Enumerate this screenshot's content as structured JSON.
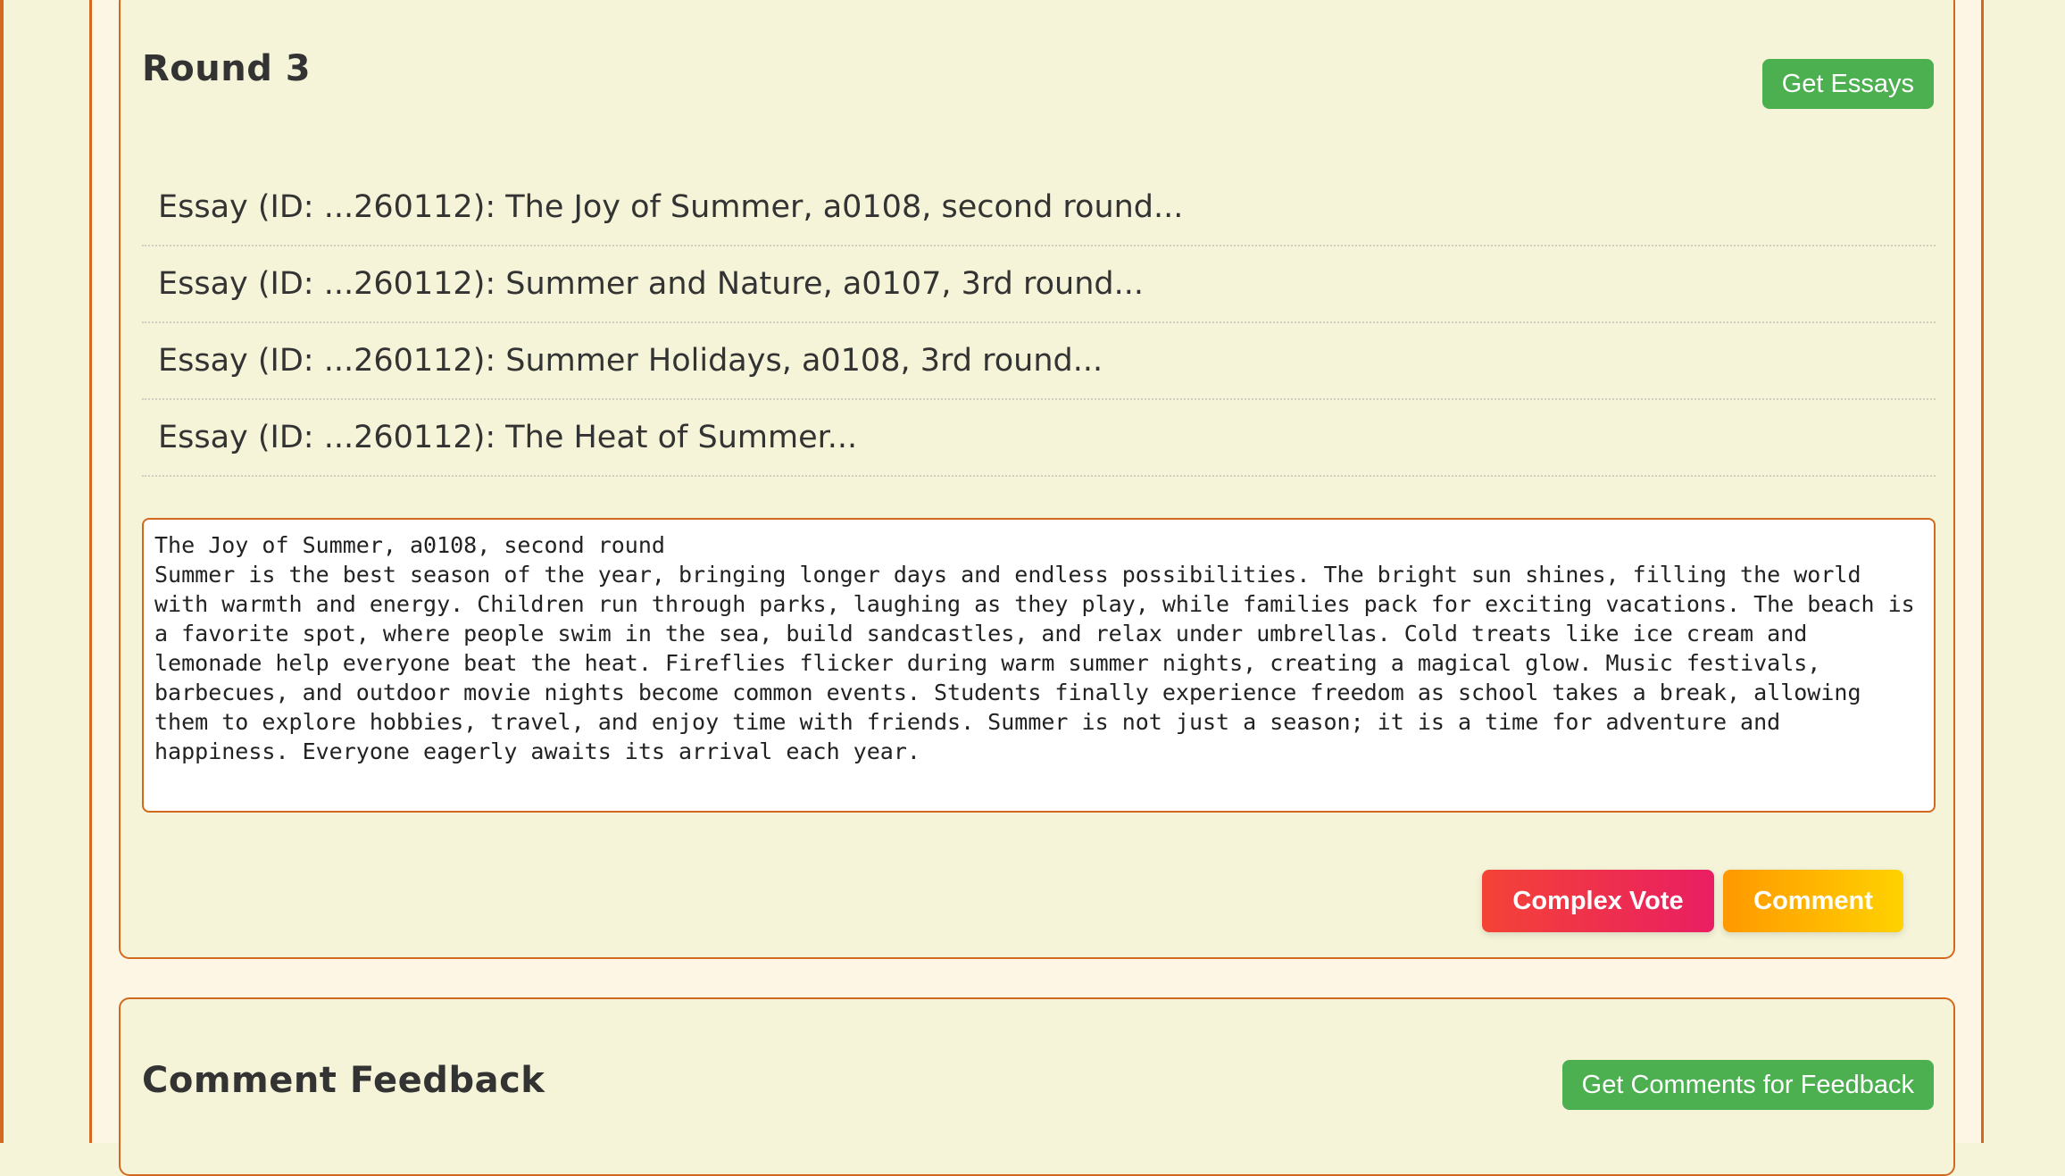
{
  "round_card": {
    "title": "Round 3",
    "get_essays_label": "Get Essays",
    "essays": [
      {
        "label": "Essay (ID: ...260112): The Joy of Summer, a0108, second round..."
      },
      {
        "label": "Essay (ID: ...260112): Summer and Nature, a0107, 3rd round..."
      },
      {
        "label": "Essay (ID: ...260112): Summer Holidays, a0108, 3rd round..."
      },
      {
        "label": "Essay (ID: ...260112): The Heat of Summer..."
      }
    ],
    "essay_text": "The Joy of Summer, a0108, second round\nSummer is the best season of the year, bringing longer days and endless possibilities. The bright sun shines, filling the world with warmth and energy. Children run through parks, laughing as they play, while families pack for exciting vacations. The beach is a favorite spot, where people swim in the sea, build sandcastles, and relax under umbrellas. Cold treats like ice cream and lemonade help everyone beat the heat. Fireflies flicker during warm summer nights, creating a magical glow. Music festivals, barbecues, and outdoor movie nights become common events. Students finally experience freedom as school takes a break, allowing them to explore hobbies, travel, and enjoy time with friends. Summer is not just a season; it is a time for adventure and happiness. Everyone eagerly awaits its arrival each year.",
    "complex_vote_label": "Complex Vote",
    "comment_label": "Comment"
  },
  "feedback_card": {
    "title": "Comment Feedback",
    "get_comments_label": "Get Comments for Feedback"
  },
  "colors": {
    "page_bg": "#f5f4d8",
    "accent_border": "#d2691e",
    "green": "#4caf50",
    "vote_gradient": [
      "#f44336",
      "#e91e63"
    ],
    "comment_gradient": [
      "#ff9800",
      "#ffd200"
    ]
  }
}
